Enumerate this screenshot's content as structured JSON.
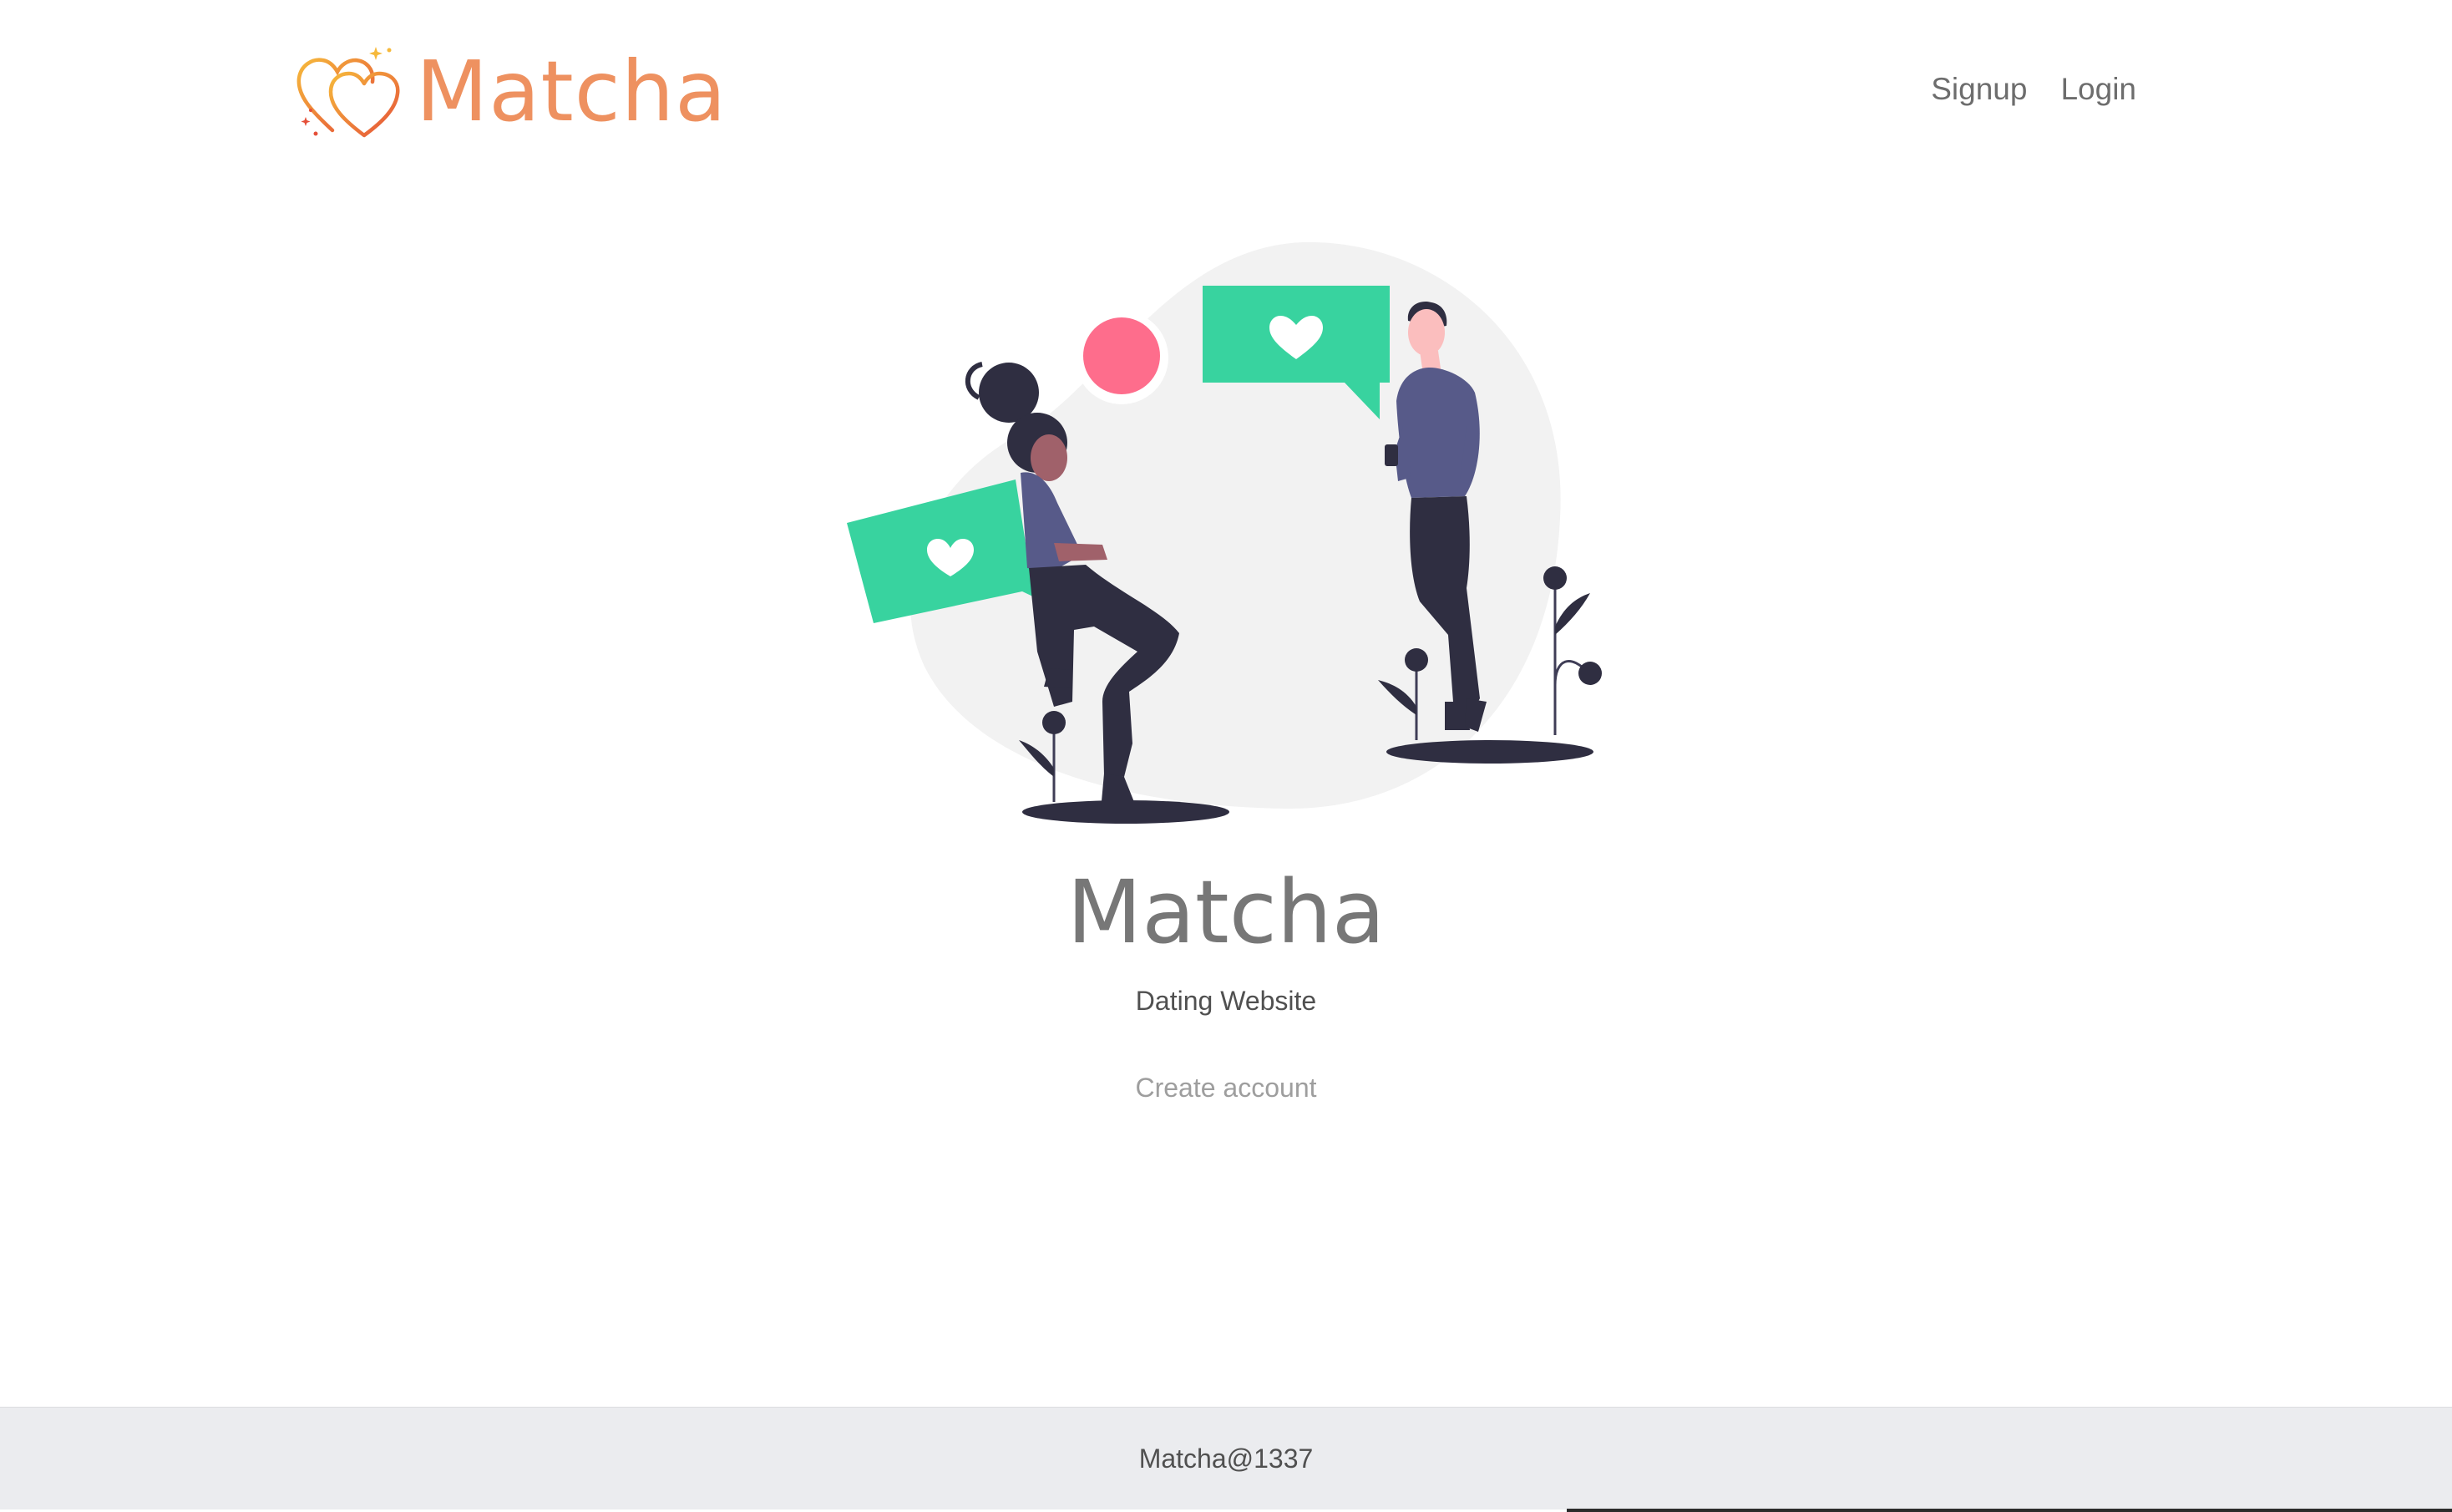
{
  "header": {
    "brand_name": "Matcha",
    "brand_color": "#ee9160",
    "logo_icon": "hearts-logo-icon",
    "nav": [
      {
        "label": "Signup"
      },
      {
        "label": "Login"
      }
    ]
  },
  "hero": {
    "illustration_icon": "couple-chat-hearts-illustration",
    "title": "Matcha",
    "subtitle": "Dating Website",
    "cta_label": "Create account",
    "accent_green": "#38d39f",
    "accent_pink": "#fe6d8c",
    "figure_color": "#2f2e41",
    "shirt_color": "#575a89"
  },
  "footer": {
    "text": "Matcha@1337"
  }
}
